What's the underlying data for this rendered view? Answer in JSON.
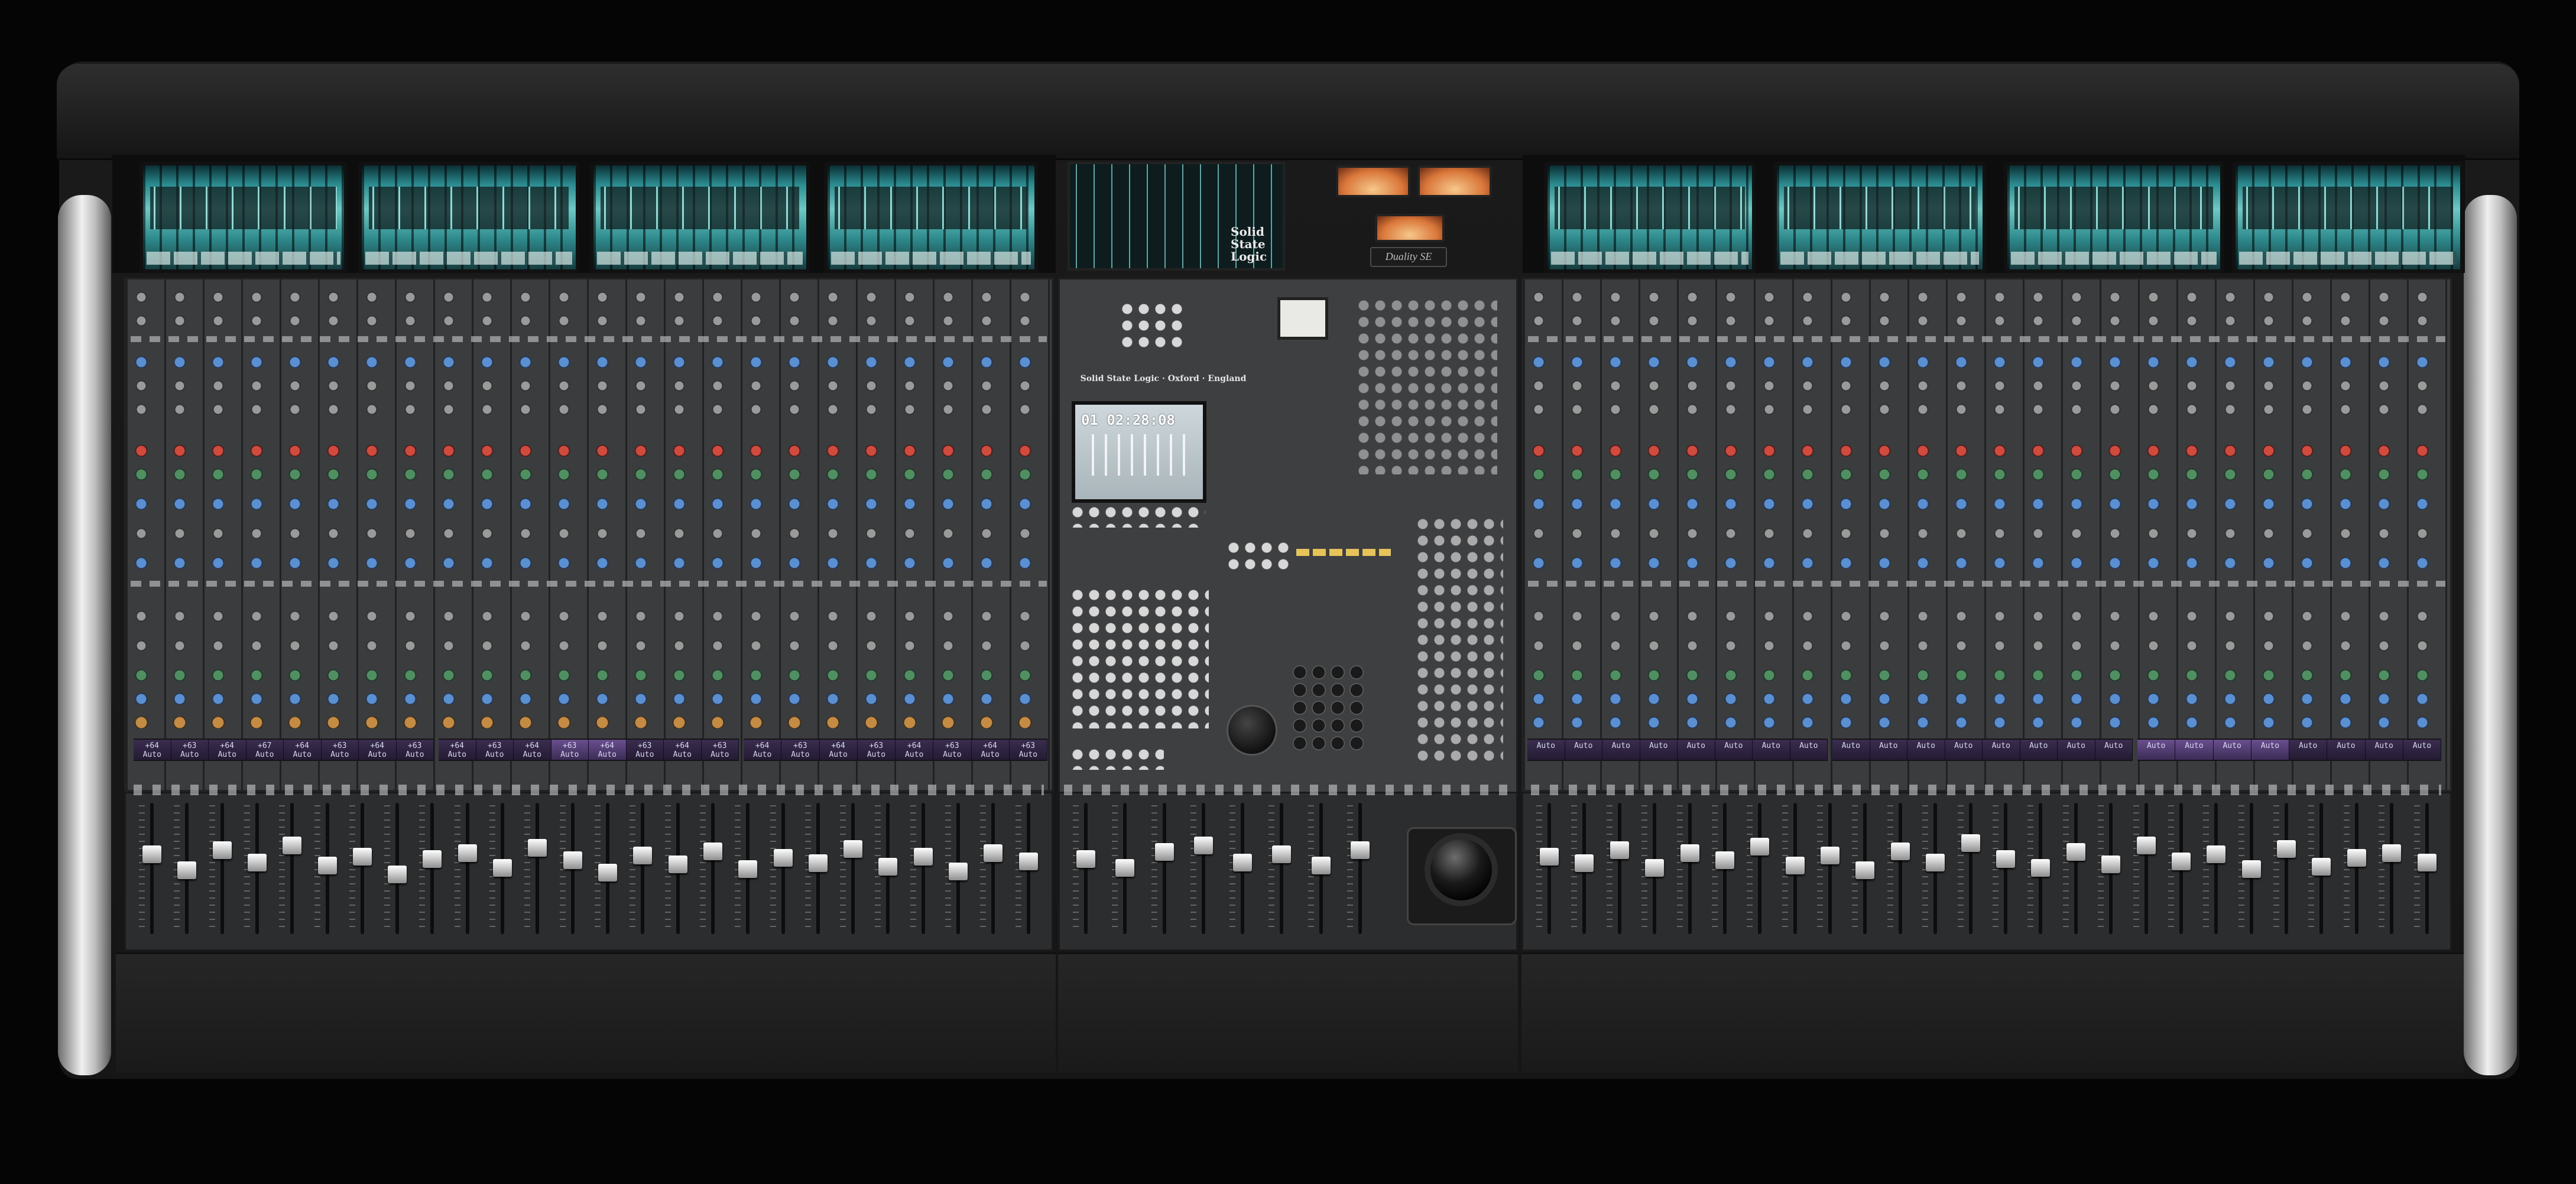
{
  "console": {
    "brand_logo_text": [
      "Solid",
      "State",
      "Logic"
    ],
    "model_badge": "Duality SE",
    "center_brand_line": "Solid State Logic · Oxford · England",
    "timecode": "01 02:28:08"
  },
  "scribble_left_a": [
    {
      "top": "+64",
      "bottom": "Auto"
    },
    {
      "top": "+63",
      "bottom": "Auto"
    },
    {
      "top": "+64",
      "bottom": "Auto"
    },
    {
      "top": "+67",
      "bottom": "Auto"
    },
    {
      "top": "+64",
      "bottom": "Auto"
    },
    {
      "top": "+63",
      "bottom": "Auto"
    },
    {
      "top": "+64",
      "bottom": "Auto"
    },
    {
      "top": "+63",
      "bottom": "Auto"
    }
  ],
  "scribble_left_b": [
    {
      "top": "+64",
      "bottom": "Auto"
    },
    {
      "top": "+63",
      "bottom": "Auto"
    },
    {
      "top": "+64",
      "bottom": "Auto"
    },
    {
      "top": "+63",
      "bottom": "Auto"
    },
    {
      "top": "+64",
      "bottom": "Auto"
    },
    {
      "top": "+63",
      "bottom": "Auto"
    },
    {
      "top": "+64",
      "bottom": "Auto"
    },
    {
      "top": "+63",
      "bottom": "Auto"
    }
  ],
  "scribble_left_c": [
    {
      "top": "+64",
      "bottom": "Auto"
    },
    {
      "top": "+63",
      "bottom": "Auto"
    },
    {
      "top": "+64",
      "bottom": "Auto"
    },
    {
      "top": "+63",
      "bottom": "Auto"
    },
    {
      "top": "+64",
      "bottom": "Auto"
    },
    {
      "top": "+63",
      "bottom": "Auto"
    },
    {
      "top": "+64",
      "bottom": "Auto"
    },
    {
      "top": "+63",
      "bottom": "Auto"
    }
  ],
  "scribble_right_a": [
    {
      "top": "",
      "bottom": "Auto"
    },
    {
      "top": "",
      "bottom": "Auto"
    },
    {
      "top": "",
      "bottom": "Auto"
    },
    {
      "top": "",
      "bottom": "Auto"
    },
    {
      "top": "",
      "bottom": "Auto"
    },
    {
      "top": "",
      "bottom": "Auto"
    },
    {
      "top": "",
      "bottom": "Auto"
    },
    {
      "top": "",
      "bottom": "Auto"
    }
  ],
  "scribble_right_b": [
    {
      "top": "",
      "bottom": "Auto"
    },
    {
      "top": "",
      "bottom": "Auto"
    },
    {
      "top": "",
      "bottom": "Auto"
    },
    {
      "top": "",
      "bottom": "Auto"
    },
    {
      "top": "",
      "bottom": "Auto"
    },
    {
      "top": "",
      "bottom": "Auto"
    },
    {
      "top": "",
      "bottom": "Auto"
    },
    {
      "top": "",
      "bottom": "Auto"
    }
  ],
  "scribble_right_c": [
    {
      "top": "",
      "bottom": "Auto"
    },
    {
      "top": "",
      "bottom": "Auto"
    },
    {
      "top": "",
      "bottom": "Auto"
    },
    {
      "top": "",
      "bottom": "Auto"
    },
    {
      "top": "",
      "bottom": "Auto"
    },
    {
      "top": "",
      "bottom": "Auto"
    },
    {
      "top": "",
      "bottom": "Auto"
    },
    {
      "top": "",
      "bottom": "Auto"
    }
  ],
  "fader_levels_left": [
    0.62,
    0.48,
    0.66,
    0.55,
    0.7,
    0.52,
    0.6,
    0.44,
    0.58,
    0.63,
    0.5,
    0.68,
    0.57,
    0.46,
    0.61,
    0.53,
    0.65,
    0.49,
    0.59,
    0.54,
    0.67,
    0.51,
    0.6,
    0.47,
    0.63,
    0.56
  ],
  "fader_levels_center": [
    0.58,
    0.5,
    0.64,
    0.7,
    0.55,
    0.62,
    0.52,
    0.66
  ],
  "fader_levels_right": [
    0.6,
    0.54,
    0.66,
    0.5,
    0.63,
    0.57,
    0.69,
    0.52,
    0.61,
    0.48,
    0.65,
    0.55,
    0.72,
    0.58,
    0.5,
    0.64,
    0.53,
    0.7,
    0.56,
    0.62,
    0.49,
    0.67,
    0.51,
    0.59,
    0.63,
    0.55
  ],
  "colors": {
    "screen_teal": "#6fc8c4",
    "scribble_violet": "#6a4f8f",
    "knob_blue": "#5a8fd2",
    "knob_red": "#d04a3e"
  },
  "icons": {
    "trackball": "trackball-icon",
    "jog_wheel": "jog-wheel-icon",
    "vu_meter": "vu-meter-icon"
  }
}
